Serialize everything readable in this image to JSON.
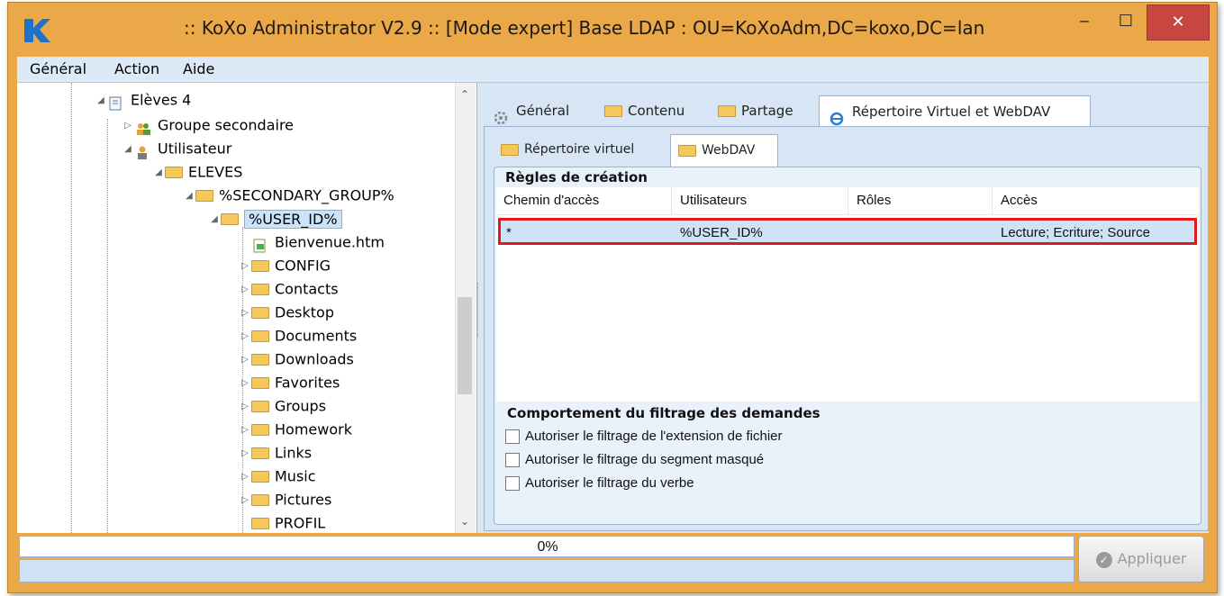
{
  "window": {
    "title": ":: KoXo Administrator V2.9 :: [Mode expert] Base LDAP : OU=KoXoAdm,DC=koxo,DC=lan",
    "app_icon": "K",
    "minimize": "‒",
    "maximize": "☐",
    "close": "✕"
  },
  "menu": [
    {
      "label": "Général"
    },
    {
      "label": "Action"
    },
    {
      "label": "Aide"
    }
  ],
  "tree": {
    "items": [
      {
        "label": "Elèves 4",
        "expander": "◢",
        "icon": "document-icon"
      },
      {
        "label": "Groupe secondaire",
        "expander": "▷",
        "icon": "group-icon"
      },
      {
        "label": "Utilisateur",
        "expander": "◢",
        "icon": "user-icon"
      },
      {
        "label": "ELEVES",
        "expander": "◢",
        "icon": "folder-icon"
      },
      {
        "label": "%SECONDARY_GROUP%",
        "expander": "◢",
        "icon": "folder-icon"
      },
      {
        "label": "%USER_ID%",
        "expander": "◢",
        "icon": "folder-icon",
        "selected": true
      },
      {
        "label": "Bienvenue.htm",
        "expander": "",
        "icon": "file-icon"
      },
      {
        "label": "CONFIG",
        "expander": "▷",
        "icon": "folder-icon"
      },
      {
        "label": "Contacts",
        "expander": "▷",
        "icon": "folder-icon"
      },
      {
        "label": "Desktop",
        "expander": "▷",
        "icon": "folder-icon"
      },
      {
        "label": "Documents",
        "expander": "▷",
        "icon": "folder-icon"
      },
      {
        "label": "Downloads",
        "expander": "▷",
        "icon": "folder-icon"
      },
      {
        "label": "Favorites",
        "expander": "▷",
        "icon": "folder-icon"
      },
      {
        "label": "Groups",
        "expander": "▷",
        "icon": "folder-icon"
      },
      {
        "label": "Homework",
        "expander": "▷",
        "icon": "folder-icon"
      },
      {
        "label": "Links",
        "expander": "▷",
        "icon": "folder-icon"
      },
      {
        "label": "Music",
        "expander": "▷",
        "icon": "folder-icon"
      },
      {
        "label": "Pictures",
        "expander": "▷",
        "icon": "folder-icon"
      },
      {
        "label": "PROFIL",
        "expander": "",
        "icon": "folder-icon"
      }
    ],
    "scroll_up": "⌃",
    "scroll_down": "⌄"
  },
  "tabs": [
    {
      "label": "Général",
      "icon": "gear-icon"
    },
    {
      "label": "Contenu",
      "icon": "folder-icon"
    },
    {
      "label": "Partage",
      "icon": "shared-folder-icon"
    },
    {
      "label": "Répertoire Virtuel et WebDAV",
      "icon": "ie-icon",
      "active": true
    }
  ],
  "subtabs": [
    {
      "label": "Répertoire virtuel",
      "icon": "virtual-folder-icon"
    },
    {
      "label": "WebDAV",
      "icon": "webdav-folder-icon",
      "active": true
    }
  ],
  "rules": {
    "title": "Règles de création",
    "columns": [
      "Chemin d'accès",
      "Utilisateurs",
      "Rôles",
      "Accès"
    ],
    "rows": [
      {
        "path": "*",
        "users": "%USER_ID%",
        "roles": "",
        "access": "Lecture; Ecriture; Source"
      }
    ]
  },
  "filtering": {
    "title": "Comportement du filtrage des demandes",
    "options": [
      {
        "label": "Autoriser le filtrage de l'extension de fichier",
        "checked": false
      },
      {
        "label": "Autoriser le filtrage du segment masqué",
        "checked": false
      },
      {
        "label": "Autoriser le filtrage du verbe",
        "checked": false
      }
    ]
  },
  "status": {
    "progress_text": "0%",
    "progress_value": 0,
    "apply_label": "Appliquer"
  },
  "colors": {
    "title_bar": "#eaa848",
    "highlight_border": "#e0191f",
    "close_button": "#c7463f"
  }
}
